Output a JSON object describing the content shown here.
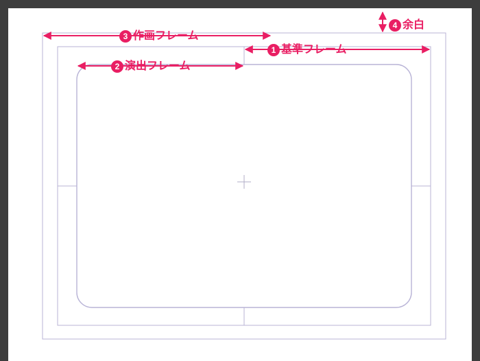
{
  "labels": {
    "n1": "1",
    "n2": "2",
    "n3": "3",
    "n4": "4",
    "l1": "基準フレーム",
    "l2": "演出フレーム",
    "l3": "作画フレーム",
    "l4": "余白"
  },
  "colors": {
    "accent": "#e91e63",
    "frame": "#b8b3d6"
  }
}
